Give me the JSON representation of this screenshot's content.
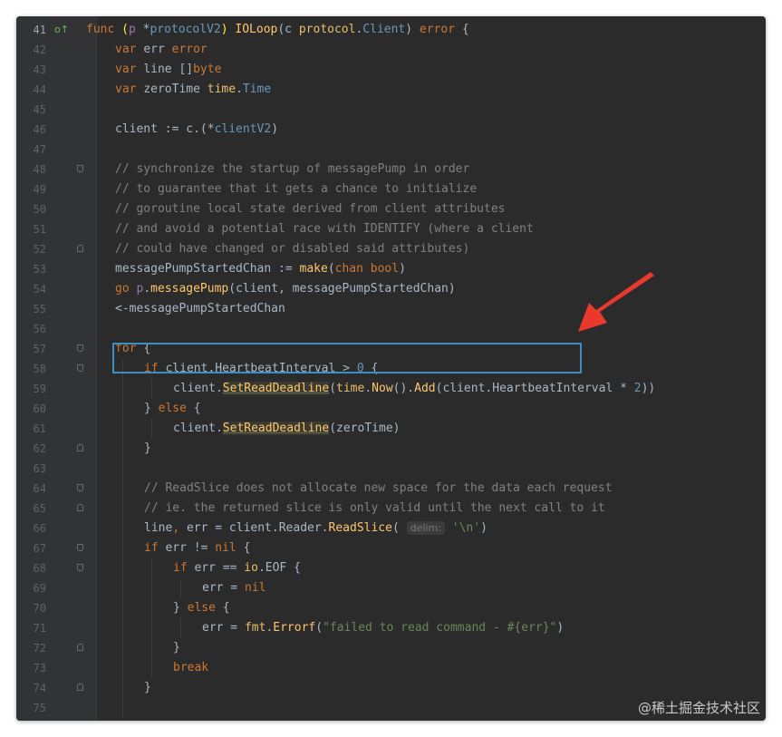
{
  "editor": {
    "lines": [
      {
        "n": "41",
        "indent": 0,
        "fold": "",
        "current": true,
        "gutter_icon": "o↑",
        "tokens": [
          {
            "t": "func ",
            "c": "kw"
          },
          {
            "t": "(",
            "c": "brk"
          },
          {
            "t": "p ",
            "c": "par"
          },
          {
            "t": "*",
            "c": ""
          },
          {
            "t": "protocolV2",
            "c": "tcl"
          },
          {
            "t": ")",
            "c": "brk"
          },
          {
            "t": " ",
            "c": ""
          },
          {
            "t": "IOLoop",
            "c": "fn"
          },
          {
            "t": "(c ",
            "c": ""
          },
          {
            "t": "protocol",
            "c": "pkg"
          },
          {
            "t": ".",
            "c": ""
          },
          {
            "t": "Client",
            "c": "tcl"
          },
          {
            "t": ") ",
            "c": ""
          },
          {
            "t": "error",
            "c": "ty"
          },
          {
            "t": " {",
            "c": ""
          }
        ]
      },
      {
        "n": "42",
        "indent": 1,
        "fold": "",
        "tokens": [
          {
            "t": "var ",
            "c": "kw"
          },
          {
            "t": "err ",
            "c": ""
          },
          {
            "t": "error",
            "c": "ty"
          }
        ]
      },
      {
        "n": "43",
        "indent": 1,
        "fold": "",
        "tokens": [
          {
            "t": "var ",
            "c": "kw"
          },
          {
            "t": "line []",
            "c": ""
          },
          {
            "t": "byte",
            "c": "ty"
          }
        ]
      },
      {
        "n": "44",
        "indent": 1,
        "fold": "",
        "tokens": [
          {
            "t": "var ",
            "c": "kw"
          },
          {
            "t": "zeroTime ",
            "c": ""
          },
          {
            "t": "time",
            "c": "pkg"
          },
          {
            "t": ".",
            "c": ""
          },
          {
            "t": "Time",
            "c": "tcl"
          }
        ]
      },
      {
        "n": "45",
        "indent": 1,
        "fold": "",
        "tokens": []
      },
      {
        "n": "46",
        "indent": 1,
        "fold": "",
        "tokens": [
          {
            "t": "client := c.(*",
            "c": ""
          },
          {
            "t": "clientV2",
            "c": "tcl"
          },
          {
            "t": ")",
            "c": ""
          }
        ]
      },
      {
        "n": "47",
        "indent": 1,
        "fold": "",
        "tokens": []
      },
      {
        "n": "48",
        "indent": 1,
        "fold": "start",
        "tokens": [
          {
            "t": "// synchronize the startup of messagePump in order",
            "c": "cm"
          }
        ]
      },
      {
        "n": "49",
        "indent": 1,
        "fold": "",
        "tokens": [
          {
            "t": "// to guarantee that it gets a chance to initialize",
            "c": "cm"
          }
        ]
      },
      {
        "n": "50",
        "indent": 1,
        "fold": "",
        "tokens": [
          {
            "t": "// goroutine local state derived from client attributes",
            "c": "cm"
          }
        ]
      },
      {
        "n": "51",
        "indent": 1,
        "fold": "",
        "tokens": [
          {
            "t": "// and avoid a potential race with IDENTIFY (where a client",
            "c": "cm"
          }
        ]
      },
      {
        "n": "52",
        "indent": 1,
        "fold": "end",
        "tokens": [
          {
            "t": "// could have changed or disabled said attributes)",
            "c": "cm"
          }
        ]
      },
      {
        "n": "53",
        "indent": 1,
        "fold": "",
        "tokens": [
          {
            "t": "messagePumpStartedChan := ",
            "c": ""
          },
          {
            "t": "make",
            "c": "fn"
          },
          {
            "t": "(",
            "c": ""
          },
          {
            "t": "chan ",
            "c": "kw"
          },
          {
            "t": "bool",
            "c": "ty"
          },
          {
            "t": ")",
            "c": ""
          }
        ]
      },
      {
        "n": "54",
        "indent": 1,
        "fold": "",
        "tokens": [
          {
            "t": "go ",
            "c": "kw"
          },
          {
            "t": "p",
            "c": "par"
          },
          {
            "t": ".",
            "c": ""
          },
          {
            "t": "messagePump",
            "c": "fn"
          },
          {
            "t": "(client, messagePumpStartedChan)",
            "c": ""
          }
        ]
      },
      {
        "n": "55",
        "indent": 1,
        "fold": "",
        "tokens": [
          {
            "t": "<-messagePumpStartedChan",
            "c": ""
          }
        ]
      },
      {
        "n": "56",
        "indent": 1,
        "fold": "",
        "tokens": []
      },
      {
        "n": "57",
        "indent": 1,
        "fold": "start",
        "tokens": [
          {
            "t": "for ",
            "c": "kw"
          },
          {
            "t": "{",
            "c": ""
          }
        ]
      },
      {
        "n": "58",
        "indent": 2,
        "fold": "start",
        "tokens": [
          {
            "t": "if ",
            "c": "kw"
          },
          {
            "t": "client.HeartbeatInterval > ",
            "c": ""
          },
          {
            "t": "0",
            "c": "num"
          },
          {
            "t": " {",
            "c": ""
          }
        ]
      },
      {
        "n": "59",
        "indent": 3,
        "fold": "",
        "tokens": [
          {
            "t": "client.",
            "c": ""
          },
          {
            "t": "SetReadDeadline",
            "c": "fnu"
          },
          {
            "t": "(",
            "c": ""
          },
          {
            "t": "time",
            "c": "pkg"
          },
          {
            "t": ".",
            "c": ""
          },
          {
            "t": "Now",
            "c": "fn"
          },
          {
            "t": "().",
            "c": ""
          },
          {
            "t": "Add",
            "c": "fn"
          },
          {
            "t": "(client.HeartbeatInterval * ",
            "c": ""
          },
          {
            "t": "2",
            "c": "num"
          },
          {
            "t": "))",
            "c": ""
          }
        ]
      },
      {
        "n": "60",
        "indent": 2,
        "fold": "mid",
        "tokens": [
          {
            "t": "} ",
            "c": ""
          },
          {
            "t": "else ",
            "c": "kw"
          },
          {
            "t": "{",
            "c": ""
          }
        ]
      },
      {
        "n": "61",
        "indent": 3,
        "fold": "",
        "tokens": [
          {
            "t": "client.",
            "c": ""
          },
          {
            "t": "SetReadDeadline",
            "c": "fnu"
          },
          {
            "t": "(zeroTime)",
            "c": ""
          }
        ]
      },
      {
        "n": "62",
        "indent": 2,
        "fold": "end",
        "tokens": [
          {
            "t": "}",
            "c": ""
          }
        ]
      },
      {
        "n": "63",
        "indent": 2,
        "fold": "",
        "tokens": []
      },
      {
        "n": "64",
        "indent": 2,
        "fold": "start",
        "tokens": [
          {
            "t": "// ReadSlice does not allocate new space for the data each request",
            "c": "cm"
          }
        ]
      },
      {
        "n": "65",
        "indent": 2,
        "fold": "end",
        "tokens": [
          {
            "t": "// ie. the returned slice is only valid until the next call to it",
            "c": "cm"
          }
        ]
      },
      {
        "n": "66",
        "indent": 2,
        "fold": "",
        "tokens": [
          {
            "t": "line",
            "c": ""
          },
          {
            "t": ", ",
            "c": "kw"
          },
          {
            "t": "err = client.Reader.",
            "c": ""
          },
          {
            "t": "ReadSlice",
            "c": "fn"
          },
          {
            "t": "( ",
            "c": ""
          },
          {
            "t": "delim:",
            "c": "hint"
          },
          {
            "t": " ",
            "c": ""
          },
          {
            "t": "'\\n'",
            "c": "str"
          },
          {
            "t": ")",
            "c": ""
          }
        ]
      },
      {
        "n": "67",
        "indent": 2,
        "fold": "start",
        "tokens": [
          {
            "t": "if ",
            "c": "kw"
          },
          {
            "t": "err != ",
            "c": ""
          },
          {
            "t": "nil",
            "c": "kw"
          },
          {
            "t": " {",
            "c": ""
          }
        ]
      },
      {
        "n": "68",
        "indent": 3,
        "fold": "start",
        "tokens": [
          {
            "t": "if ",
            "c": "kw"
          },
          {
            "t": "err == ",
            "c": ""
          },
          {
            "t": "io",
            "c": "pkg"
          },
          {
            "t": ".EOF {",
            "c": ""
          }
        ]
      },
      {
        "n": "69",
        "indent": 4,
        "fold": "",
        "tokens": [
          {
            "t": "err = ",
            "c": ""
          },
          {
            "t": "nil",
            "c": "kw"
          }
        ]
      },
      {
        "n": "70",
        "indent": 3,
        "fold": "mid",
        "tokens": [
          {
            "t": "} ",
            "c": ""
          },
          {
            "t": "else ",
            "c": "kw"
          },
          {
            "t": "{",
            "c": ""
          }
        ]
      },
      {
        "n": "71",
        "indent": 4,
        "fold": "",
        "tokens": [
          {
            "t": "err = ",
            "c": ""
          },
          {
            "t": "fmt",
            "c": "pkg"
          },
          {
            "t": ".",
            "c": ""
          },
          {
            "t": "Errorf",
            "c": "fn"
          },
          {
            "t": "(",
            "c": ""
          },
          {
            "t": "\"failed to read command - #{err}\"",
            "c": "str"
          },
          {
            "t": ")",
            "c": ""
          }
        ]
      },
      {
        "n": "72",
        "indent": 3,
        "fold": "end",
        "tokens": [
          {
            "t": "}",
            "c": ""
          }
        ]
      },
      {
        "n": "73",
        "indent": 3,
        "fold": "",
        "tokens": [
          {
            "t": "break",
            "c": "kw"
          }
        ]
      },
      {
        "n": "74",
        "indent": 2,
        "fold": "end",
        "tokens": [
          {
            "t": "}",
            "c": ""
          }
        ]
      },
      {
        "n": "75",
        "indent": 2,
        "fold": "",
        "tokens": []
      }
    ]
  },
  "annotation": {
    "box_color": "#3d8ec2",
    "arrow_color": "#e8392c"
  },
  "watermark": {
    "text": "@稀土掘金技术社区"
  }
}
